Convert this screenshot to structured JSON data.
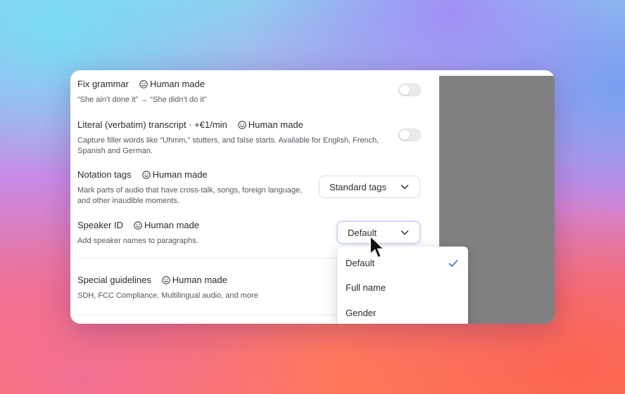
{
  "badge_label": "Human made",
  "options": [
    {
      "title": "Fix grammar",
      "description": "“She ain’t done it” → “She didn’t do it”",
      "control": "toggle",
      "enabled": false
    },
    {
      "title": "Literal (verbatim) transcript · +€1/min",
      "description": "Capture filler words like “Uhmm,” stutters, and false starts. Available for English, French, Spanish and German.",
      "control": "toggle",
      "enabled": false
    },
    {
      "title": "Notation tags",
      "description": "Mark parts of audio that have cross-talk, songs, foreign language, and other inaudible moments.",
      "control": "select",
      "selected": "Standard tags"
    },
    {
      "title": "Speaker ID",
      "description": "Add speaker names to paragraphs.",
      "control": "select",
      "selected": "Default"
    },
    {
      "title": "Special guidelines",
      "description": "SDH, FCC Compliance, Multilingual audio, and more"
    }
  ],
  "speaker_menu": {
    "items": [
      "Default",
      "Full name",
      "Gender"
    ],
    "checked": "Default"
  },
  "colors": {
    "accent": "#3b5bdb",
    "panel_gray": "#808083"
  },
  "icons": {
    "badge": "smile-icon",
    "select": "chevron-down-icon",
    "checked": "check-icon",
    "pointer": "mouse-pointer-icon"
  }
}
